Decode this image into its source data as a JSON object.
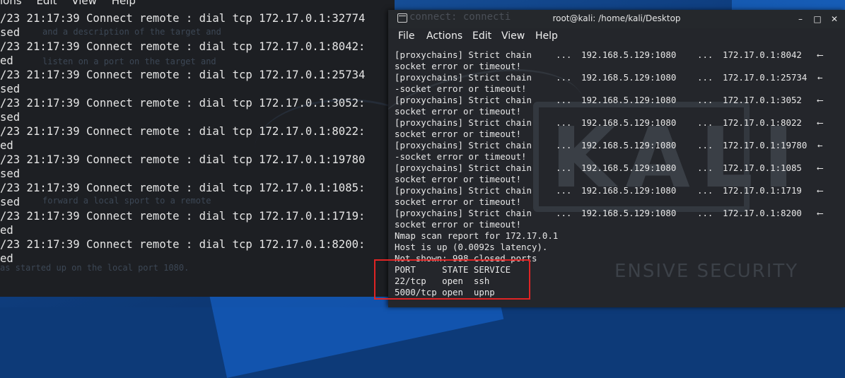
{
  "left_terminal": {
    "menu": [
      "ions",
      "Edit",
      "View",
      "Help"
    ],
    "lines": [
      "/23 21:17:39 Connect remote : dial tcp 172.17.0.1:32774",
      "sed",
      "/23 21:17:39 Connect remote : dial tcp 172.17.0.1:8042:",
      "ed",
      "/23 21:17:39 Connect remote : dial tcp 172.17.0.1:25734",
      "sed",
      "/23 21:17:39 Connect remote : dial tcp 172.17.0.1:3052:",
      "sed",
      "/23 21:17:39 Connect remote : dial tcp 172.17.0.1:8022:",
      "ed",
      "/23 21:17:39 Connect remote : dial tcp 172.17.0.1:19780",
      "sed",
      "/23 21:17:39 Connect remote : dial tcp 172.17.0.1:1085:",
      "sed",
      "/23 21:17:39 Connect remote : dial tcp 172.17.0.1:1719:",
      "ed",
      "/23 21:17:39 Connect remote : dial tcp 172.17.0.1:8200:",
      "ed"
    ],
    "background_text": [
      "and a description of the target and",
      "listen on a port on the target and",
      "forward a local sport to a remote",
      "as started up on the local port 1080."
    ]
  },
  "right_terminal": {
    "title_ghost": "connect: connecti",
    "title": "root@kali: /home/kali/Desktop",
    "menu": [
      "File",
      "Actions",
      "Edit",
      "View",
      "Help"
    ],
    "chain_rows": [
      {
        "line1": "[proxychains] Strict chain",
        "dots1": "...",
        "proxy": "192.168.5.129:1080",
        "dots2": "...",
        "target": "172.17.0.1:8042",
        "arrow": "⟵",
        "line2": "socket error or timeout!"
      },
      {
        "line1": "[proxychains] Strict chain",
        "dots1": "...",
        "proxy": "192.168.5.129:1080",
        "dots2": "...",
        "target": "172.17.0.1:25734",
        "arrow": "←",
        "line2": "-socket error or timeout!"
      },
      {
        "line1": "[proxychains] Strict chain",
        "dots1": "...",
        "proxy": "192.168.5.129:1080",
        "dots2": "...",
        "target": "172.17.0.1:3052",
        "arrow": "⟵",
        "line2": "socket error or timeout!"
      },
      {
        "line1": "[proxychains] Strict chain",
        "dots1": "...",
        "proxy": "192.168.5.129:1080",
        "dots2": "...",
        "target": "172.17.0.1:8022",
        "arrow": "⟵",
        "line2": "socket error or timeout!"
      },
      {
        "line1": "[proxychains] Strict chain",
        "dots1": "...",
        "proxy": "192.168.5.129:1080",
        "dots2": "...",
        "target": "172.17.0.1:19780",
        "arrow": "←",
        "line2": "-socket error or timeout!"
      },
      {
        "line1": "[proxychains] Strict chain",
        "dots1": "...",
        "proxy": "192.168.5.129:1080",
        "dots2": "...",
        "target": "172.17.0.1:1085",
        "arrow": "⟵",
        "line2": "socket error or timeout!"
      },
      {
        "line1": "[proxychains] Strict chain",
        "dots1": "...",
        "proxy": "192.168.5.129:1080",
        "dots2": "...",
        "target": "172.17.0.1:1719",
        "arrow": "⟵",
        "line2": "socket error or timeout!"
      },
      {
        "line1": "[proxychains] Strict chain",
        "dots1": "...",
        "proxy": "192.168.5.129:1080",
        "dots2": "...",
        "target": "172.17.0.1:8200",
        "arrow": "⟵",
        "line2": "socket error or timeout!"
      }
    ],
    "nmap": {
      "report": "Nmap scan report for 172.17.0.1",
      "host": "Host is up (0.0092s latency).",
      "not_shown": "Not shown: 998 closed ports",
      "header": "PORT     STATE SERVICE",
      "ports": [
        "22/tcp   open  ssh",
        "5000/tcp open  upnp"
      ]
    },
    "watermark": "KALI",
    "watermark_sub": "ENSIVE SECURITY"
  },
  "colors": {
    "highlight": "#e02424",
    "terminal_bg": "#24262b"
  }
}
